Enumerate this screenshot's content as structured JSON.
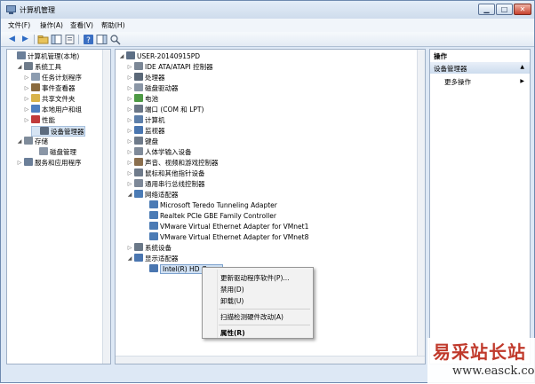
{
  "window": {
    "title": "计算机管理"
  },
  "controls": {
    "minimize": "▁",
    "maximize": "□",
    "close": "✕"
  },
  "menu": [
    "文件(F)",
    "操作(A)",
    "查看(V)",
    "帮助(H)"
  ],
  "left_tree": [
    {
      "label": "计算机管理(本地)",
      "expander": "",
      "icon_color": "#6b7f99"
    },
    {
      "label": "系统工具",
      "expander": "◢",
      "icon_color": "#6e7b8a"
    },
    {
      "label": "任务计划程序",
      "expander": "▷",
      "icon_color": "#8c9cb0"
    },
    {
      "label": "事件查看器",
      "expander": "▷",
      "icon_color": "#8a6a3e"
    },
    {
      "label": "共享文件夹",
      "expander": "▷",
      "icon_color": "#d9b34a"
    },
    {
      "label": "本地用户和组",
      "expander": "▷",
      "icon_color": "#4f7fc0"
    },
    {
      "label": "性能",
      "expander": "▷",
      "icon_color": "#c03a3a"
    },
    {
      "label": "设备管理器",
      "expander": "",
      "icon_color": "#5c6b7e"
    },
    {
      "label": "存储",
      "expander": "◢",
      "icon_color": "#7f8c9b"
    },
    {
      "label": "磁盘管理",
      "expander": "",
      "icon_color": "#8a96a6"
    },
    {
      "label": "服务和应用程序",
      "expander": "▷",
      "icon_color": "#6b7f99"
    }
  ],
  "device_tree": [
    {
      "label": "USER-20140915PD",
      "expander": "◢",
      "icon_color": "#5d6f85"
    },
    {
      "label": "IDE ATA/ATAPI 控制器",
      "expander": "▷",
      "icon_color": "#7b8796"
    },
    {
      "label": "处理器",
      "expander": "▷",
      "icon_color": "#5a6878"
    },
    {
      "label": "磁盘驱动器",
      "expander": "▷",
      "icon_color": "#8a96a6"
    },
    {
      "label": "电池",
      "expander": "▷",
      "icon_color": "#4e9a45"
    },
    {
      "label": "端口 (COM 和 LPT)",
      "expander": "▷",
      "icon_color": "#6a7686"
    },
    {
      "label": "计算机",
      "expander": "▷",
      "icon_color": "#5d7faa"
    },
    {
      "label": "监视器",
      "expander": "▷",
      "icon_color": "#4a76b0"
    },
    {
      "label": "键盘",
      "expander": "▷",
      "icon_color": "#6e7a8a"
    },
    {
      "label": "人体学输入设备",
      "expander": "▷",
      "icon_color": "#7f8a99"
    },
    {
      "label": "声音、视频和游戏控制器",
      "expander": "▷",
      "icon_color": "#8b6f4e"
    },
    {
      "label": "鼠标和其他指针设备",
      "expander": "▷",
      "icon_color": "#6f7b8b"
    },
    {
      "label": "通用串行总线控制器",
      "expander": "▷",
      "icon_color": "#7d8898"
    },
    {
      "label": "网络适配器",
      "expander": "◢",
      "icon_color": "#4b7bb5"
    },
    {
      "label": "Microsoft Teredo Tunneling Adapter",
      "expander": "",
      "icon_color": "#4b7bb5"
    },
    {
      "label": "Realtek PCIe GBE Family Controller",
      "expander": "",
      "icon_color": "#4b7bb5"
    },
    {
      "label": "VMware Virtual Ethernet Adapter for VMnet1",
      "expander": "",
      "icon_color": "#4b7bb5"
    },
    {
      "label": "VMware Virtual Ethernet Adapter for VMnet8",
      "expander": "",
      "icon_color": "#4b7bb5"
    },
    {
      "label": "系统设备",
      "expander": "▷",
      "icon_color": "#6a7888"
    },
    {
      "label": "显示适配器",
      "expander": "◢",
      "icon_color": "#4a76b0"
    },
    {
      "label": "Intel(R) HD Gra...",
      "expander": "",
      "icon_color": "#4a76b0"
    }
  ],
  "actions": {
    "header": "操作",
    "section": "设备管理器",
    "section_arrow": "▲",
    "more": "更多操作",
    "more_arrow": "▶"
  },
  "context_menu": [
    "更新驱动程序软件(P)...",
    "禁用(D)",
    "卸载(U)",
    "扫描检测硬件改动(A)",
    "属性(R)"
  ],
  "watermark": {
    "cn": "易采站长站",
    "url": "www.easck.com"
  }
}
